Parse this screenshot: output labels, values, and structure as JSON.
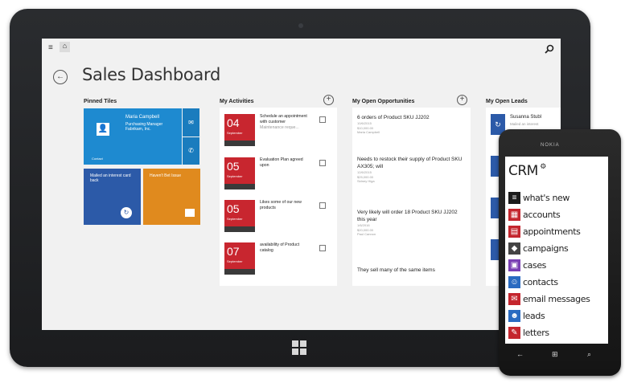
{
  "page": {
    "title": "Sales Dashboard"
  },
  "sections": {
    "pinned": "Pinned Tiles",
    "activities": "My Activities",
    "opportunities": "My Open Opportunities",
    "leads": "My Open Leads"
  },
  "pinned_tiles": {
    "contact_name": "Maria Campbell",
    "contact_role": "Purchasing Manager",
    "contact_company": "Fabrikam, Inc.",
    "contact_label": "Contact",
    "tile2_text": "Mailed an interest card back",
    "tile3_text": "Haven't Bet Issue"
  },
  "activities": [
    {
      "day": "04",
      "month": "September",
      "text": "Schedule an appointment with customer",
      "sub": "Maintenance reque..."
    },
    {
      "day": "05",
      "month": "September",
      "text": "Evaluation Plan agreed upon",
      "sub": ""
    },
    {
      "day": "05",
      "month": "September",
      "text": "Likes some of our new products",
      "sub": ""
    },
    {
      "day": "07",
      "month": "September",
      "text": "availability of Product catalog",
      "sub": ""
    }
  ],
  "opportunities": [
    {
      "title": "6 orders of Product SKU JJ202",
      "meta": [
        "10/6/2015",
        "$10,000.00",
        "Maria Campbell"
      ]
    },
    {
      "title": "Needs to restock their supply of Product SKU AX305; will",
      "meta": [
        "12/6/2015",
        "$25,000.00",
        "Sidney Higa"
      ]
    },
    {
      "title": "Very likely will order 18 Product SKU JJ202 this year",
      "meta": [
        "1/6/2016",
        "$20,000.00",
        "Paul Cannon"
      ]
    },
    {
      "title": "They sell many of the same items",
      "meta": []
    }
  ],
  "leads": {
    "first_name": "Susanna Stubl",
    "first_sub": "Mailed an interest"
  },
  "phone": {
    "brand": "NOKIA",
    "app_title": "CRM",
    "items": [
      {
        "label": "what's new",
        "icon": "whats-new-icon",
        "color": "#1b1b1b"
      },
      {
        "label": "accounts",
        "icon": "accounts-icon",
        "color": "#c4262e"
      },
      {
        "label": "appointments",
        "icon": "appointments-icon",
        "color": "#c4262e"
      },
      {
        "label": "campaigns",
        "icon": "campaigns-icon",
        "color": "#444444"
      },
      {
        "label": "cases",
        "icon": "cases-icon",
        "color": "#7a3fb3"
      },
      {
        "label": "contacts",
        "icon": "contacts-icon",
        "color": "#2a6bc1"
      },
      {
        "label": "email messages",
        "icon": "email-icon",
        "color": "#c4262e"
      },
      {
        "label": "leads",
        "icon": "leads-icon",
        "color": "#2a6bc1"
      },
      {
        "label": "letters",
        "icon": "letters-icon",
        "color": "#c4262e"
      }
    ]
  },
  "colors": {
    "tile_blue": "#1e8ad0",
    "tile_navy": "#2c5aa8",
    "tile_orange": "#e08a1e",
    "activity_red": "#c8262f"
  }
}
